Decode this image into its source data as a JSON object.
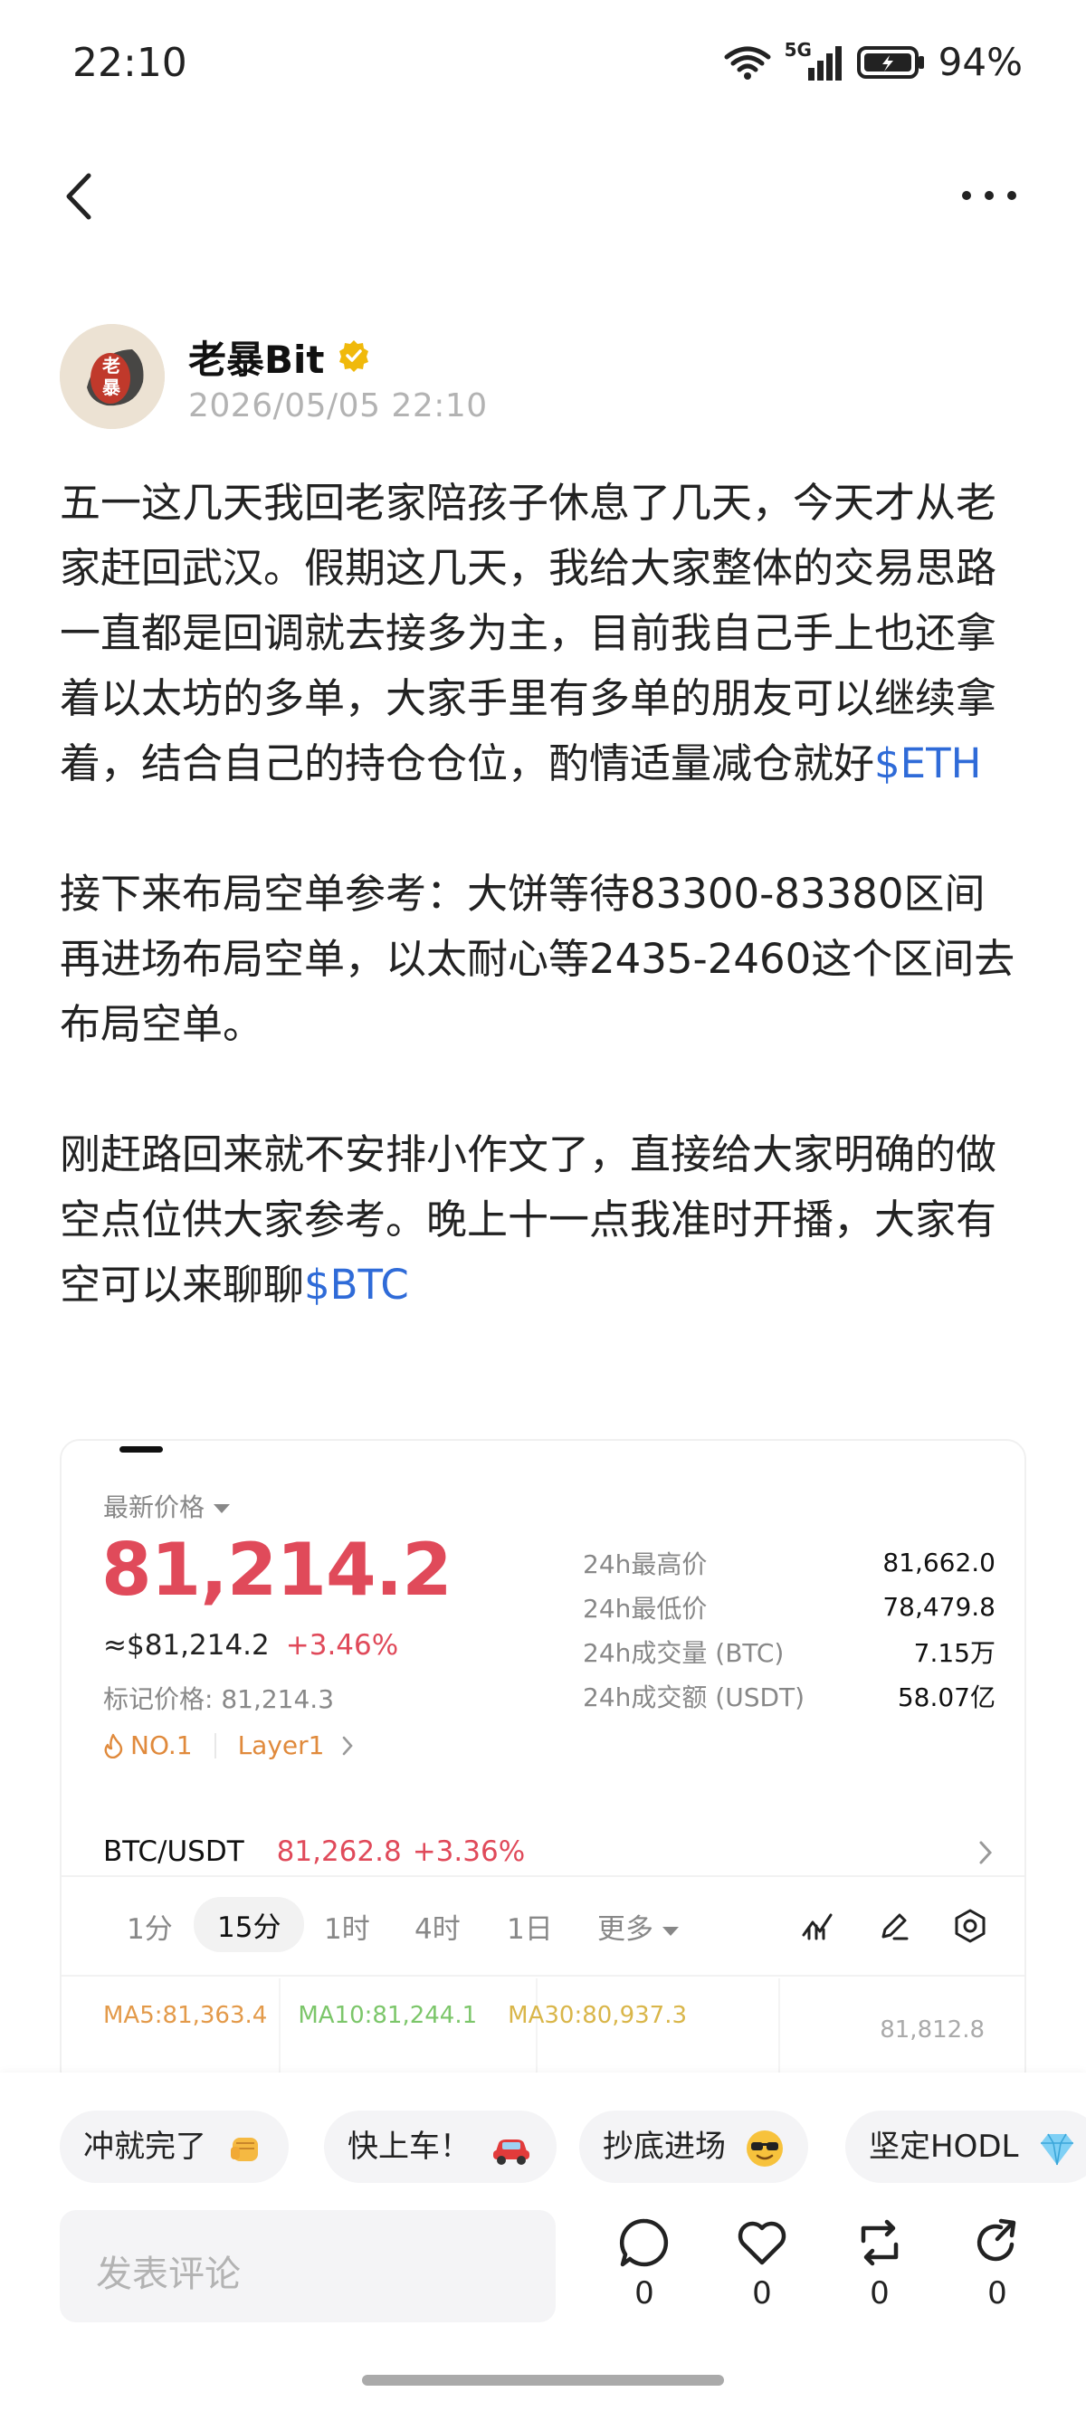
{
  "status_bar": {
    "time": "22:10",
    "battery": "94%",
    "network": "5G"
  },
  "nav": {
    "back_icon": "chevron-left-icon",
    "more_icon": "more-horizontal-icon"
  },
  "author": {
    "name": "老暴Bit",
    "avatar_text": "老暴",
    "verified": true,
    "timestamp": "2026/05/05 22:10"
  },
  "post": {
    "paragraph1": "五一这几天我回老家陪孩子休息了几天，今天才从老家赶回武汉。假期这几天，我给大家整体的交易思路一直都是回调就去接多为主，目前我自己手上也还拿着以太坊的多单，大家手里有多单的朋友可以继续拿着，结合自己的持仓仓位，酌情适量减仓就好",
    "tag1": "$ETH",
    "paragraph2": "接下来布局空单参考：大饼等待83300-83380区间再进场布局空单，以太耐心等2435-2460这个区间去布局空单。",
    "paragraph3": "刚赶路回来就不安排小作文了，直接给大家明确的做空点位供大家参考。晚上十一点我准时开播，大家有空可以来聊聊",
    "tag2": "$BTC"
  },
  "market_card": {
    "latest_label": "最新价格",
    "price": "81,214.2",
    "usd_price": "≈$81,214.2",
    "change": "+3.46%",
    "mark_price": "标记价格: 81,214.3",
    "rank_chip": "NO.1",
    "category_chip": "Layer1",
    "stats": [
      {
        "label": "24h最高价",
        "value": "81,662.0"
      },
      {
        "label": "24h最低价",
        "value": "78,479.8"
      },
      {
        "label": "24h成交量 (BTC)",
        "value": "7.15万"
      },
      {
        "label": "24h成交额 (USDT)",
        "value": "58.07亿"
      }
    ],
    "pair": {
      "name": "BTC/USDT",
      "price": "81,262.8",
      "change": "+3.36%"
    },
    "timeframes": [
      "1分",
      "15分",
      "1时",
      "4时",
      "1日",
      "更多"
    ],
    "active_timeframe": "15分",
    "ma": {
      "ma5": "MA5:81,363.4",
      "ma10": "MA10:81,244.1",
      "ma30": "MA30:80,937.3"
    },
    "axis_price": "81,812.8",
    "colors": {
      "up": "#e04a5a",
      "chip": "#e08a3c",
      "ma5": "#e39a4a",
      "ma10": "#7cc66a",
      "ma30": "#d9b64a",
      "tag": "#2f6bd8"
    }
  },
  "quick_replies": [
    {
      "label": "冲就完了",
      "icon": "fist-emoji"
    },
    {
      "label": "快上车！",
      "icon": "car-emoji"
    },
    {
      "label": "抄底进场",
      "icon": "sunglasses-emoji"
    },
    {
      "label": "坚定HODL",
      "icon": "diamond-emoji"
    }
  ],
  "comment": {
    "placeholder": "发表评论"
  },
  "actions": [
    {
      "name": "comment",
      "count": "0"
    },
    {
      "name": "like",
      "count": "0"
    },
    {
      "name": "repost",
      "count": "0"
    },
    {
      "name": "share",
      "count": "0"
    }
  ]
}
